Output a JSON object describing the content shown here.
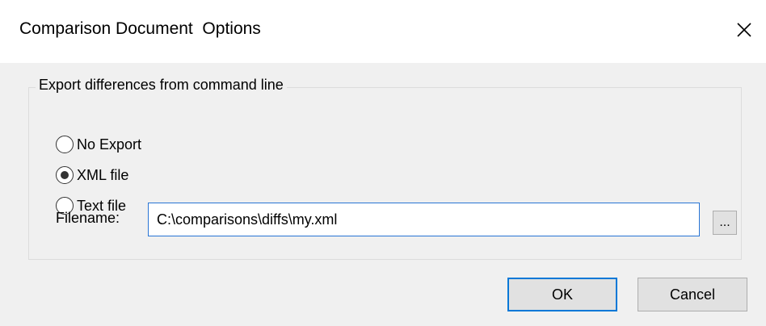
{
  "window": {
    "title": "Comparison Document  Options",
    "close_icon": "close-icon"
  },
  "export_group": {
    "legend": "Export differences from command line",
    "options": [
      {
        "label": "No Export",
        "selected": false
      },
      {
        "label": "XML file",
        "selected": true
      },
      {
        "label": "Text file",
        "selected": false
      }
    ],
    "filename_label": "Filename:",
    "filename_value": "C:\\comparisons\\diffs\\my.xml",
    "browse_label": "..."
  },
  "buttons": {
    "ok_label": "OK",
    "cancel_label": "Cancel"
  },
  "colors": {
    "focus_accent": "#0078d7",
    "dialog_body": "#f0f0f0"
  }
}
